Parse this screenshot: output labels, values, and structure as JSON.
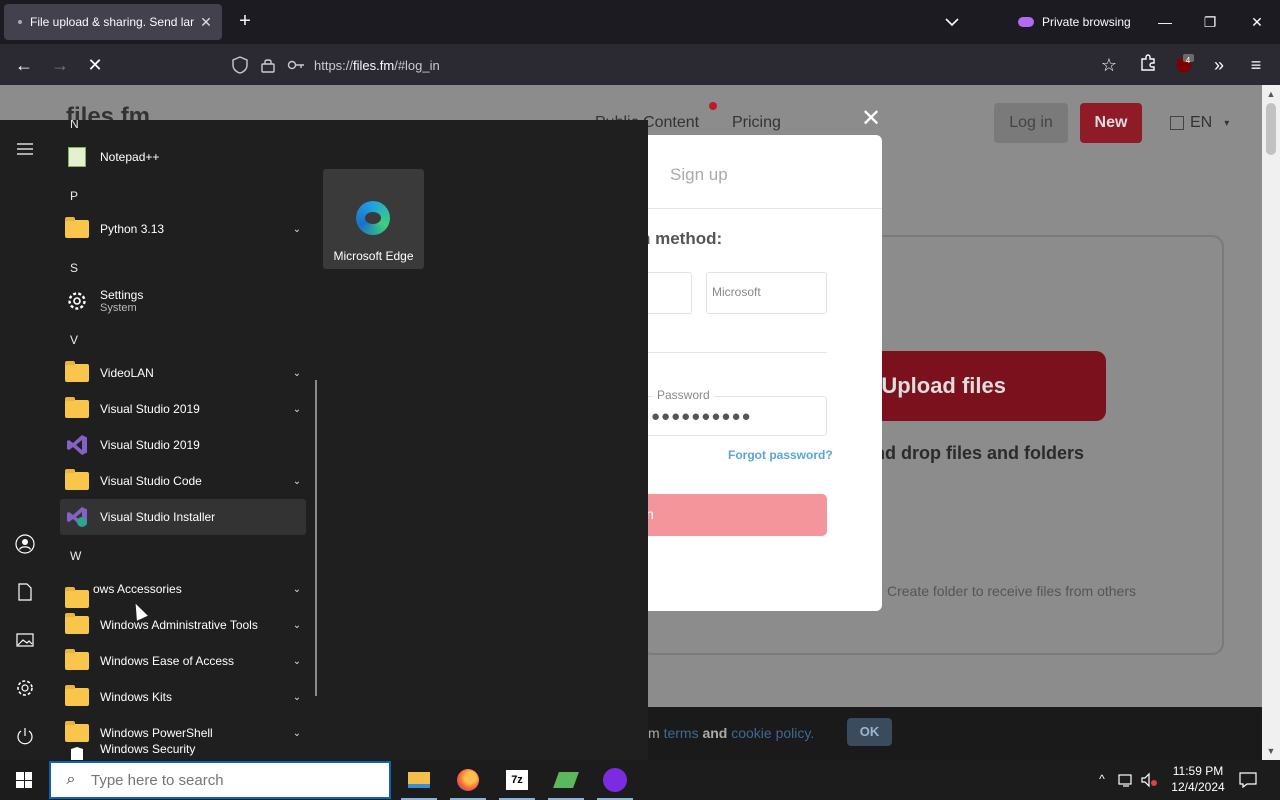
{
  "browser": {
    "tab_title": "File upload & sharing. Send lar",
    "private_label": "Private browsing",
    "url_scheme": "https://",
    "url_host": "files.fm",
    "url_path": "/#log_in",
    "extension_badge": "4"
  },
  "site": {
    "logo": "files.fm",
    "menu_items": [
      "Public Content",
      "Pricing"
    ],
    "login_label": "Log in",
    "new_label": "New",
    "lang": "EN",
    "upload_label": "Upload files",
    "drop_text": "nd drop files and folders",
    "create_folder": "Create folder to receive files from others",
    "cookie_prefix": "m",
    "cookie_terms": "terms",
    "cookie_and": "and",
    "cookie_policy": "cookie policy.",
    "cookie_ok": "OK"
  },
  "modal": {
    "signup_tab": "Sign up",
    "method_heading": "n method:",
    "oauth_second": "Microsoft",
    "password_label": "Password",
    "password_value": "●●●●●●●●●●",
    "forgot": "Forgot password?",
    "submit_fragment": "n"
  },
  "start_menu": {
    "tile_label": "Microsoft Edge",
    "letters": {
      "n": "N",
      "p": "P",
      "s": "S",
      "v": "V",
      "w": "W"
    },
    "apps": {
      "notepad": "Notepad++",
      "python": "Python 3.13",
      "settings": "Settings",
      "settings_sub": "System",
      "videolan": "VideoLAN",
      "vs2019_folder": "Visual Studio 2019",
      "vs2019": "Visual Studio 2019",
      "vscode": "Visual Studio Code",
      "vs_installer": "Visual Studio Installer",
      "win_accessories": "ows Accessories",
      "win_admin": "Windows Administrative Tools",
      "win_ease": "Windows Ease of Access",
      "win_kits": "Windows Kits",
      "win_powershell": "Windows PowerShell",
      "win_security": "Windows Security"
    }
  },
  "taskbar": {
    "search_placeholder": "Type here to search",
    "time": "11:59 PM",
    "date": "12/4/2024"
  }
}
